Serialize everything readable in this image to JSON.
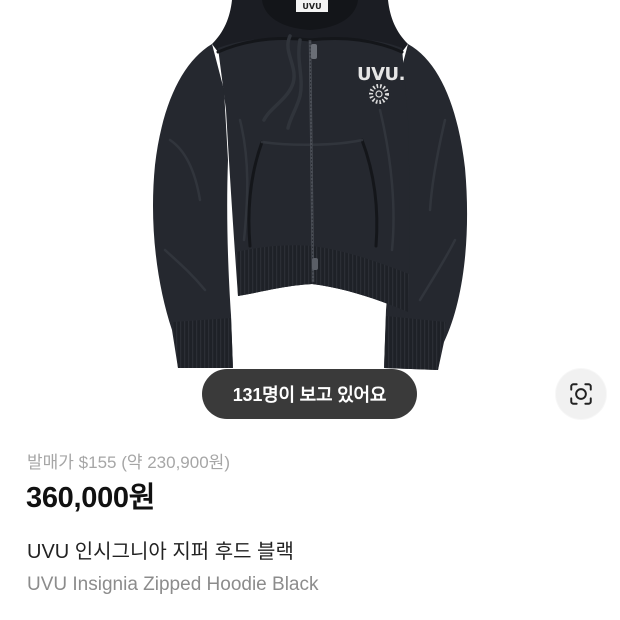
{
  "product_image": {
    "garment_tag_text": "UVU",
    "garment_logo_text": "UVU.",
    "viewers_badge": "131명이 보고 있어요",
    "image_search_button": {
      "icon": "image-search-icon"
    }
  },
  "product_info": {
    "release_price_label": "발매가",
    "release_price_value": "$155 (약 230,900원)",
    "price": "360,000원",
    "name_ko": "UVU 인시그니아 지퍼 후드 블랙",
    "name_en": "UVU Insignia Zipped Hoodie Black"
  },
  "colors": {
    "page_background": "#ffffff",
    "badge_background": "#3a3a3a",
    "badge_text": "#ffffff",
    "release_price_text": "#a6a6a6",
    "price_text": "#111111",
    "name_ko_text": "#222222",
    "name_en_text": "#8c8c8c",
    "garment_color": "#25282f"
  }
}
